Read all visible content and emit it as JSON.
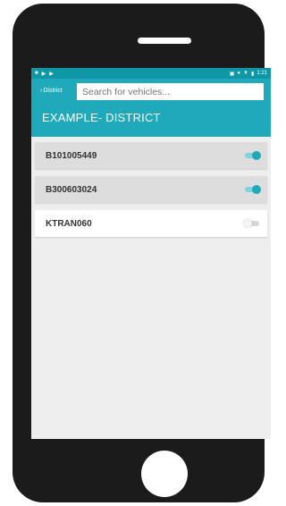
{
  "statusbar": {
    "left_icons": [
      "notification-icon",
      "play-icon",
      "play-icon"
    ],
    "right_icons": [
      "sim-icon",
      "location-icon",
      "wifi-icon",
      "battery-icon"
    ],
    "time": "1:21"
  },
  "header": {
    "back_label": "District",
    "search_placeholder": "Search for vehicles...",
    "district_title": "EXAMPLE- DISTRICT"
  },
  "vehicles": [
    {
      "name": "B101005449",
      "enabled": true
    },
    {
      "name": "B300603024",
      "enabled": true
    },
    {
      "name": "KTRAN060",
      "enabled": false
    }
  ],
  "colors": {
    "accent": "#1fa9ba",
    "statusbar": "#0f97a8",
    "active_row": "#dddddd",
    "inactive_row": "#ffffff",
    "phone_body": "#1b1b1b"
  }
}
